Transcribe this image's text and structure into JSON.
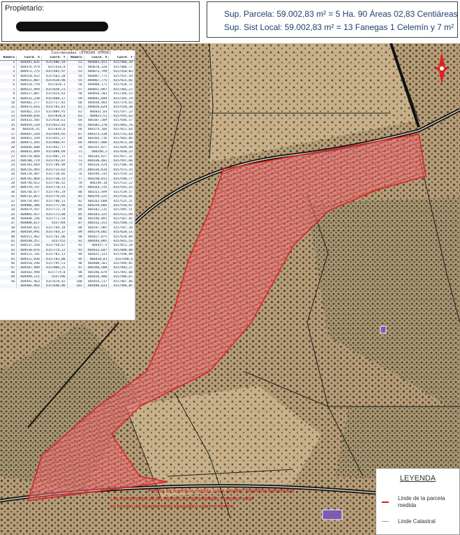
{
  "header": {
    "owner_label": "Propietario:",
    "surface_parcel": "Sup. Parcela: 59.002,83 m² = 5 Ha.  90 Áreas 02,83 Centiáreas",
    "surface_local": "Sup. Sist Local: 59.002,83 m² = 13 Fanegas 1 Celemín y 7 m²"
  },
  "coords": {
    "title": "Coordenadas (ETRS89 UTM30)",
    "headers": [
      "Número",
      "Coord. X",
      "Coord. Y",
      "Número",
      "Coord. X",
      "Coord. Y"
    ],
    "rows": [
      [
        "1",
        "404491,835",
        "4157406,59",
        "51",
        "404883,453",
        "4157406,39"
      ],
      [
        "2",
        "404476,979",
        "4157418,8",
        "52",
        "404878,226",
        "4157406,77"
      ],
      [
        "3",
        "404471,775",
        "4157485,97",
        "53",
        "404871,799",
        "4157410,03"
      ],
      [
        "4",
        "404510,932",
        "4157563,28",
        "54",
        "404867,773",
        "4157415,59"
      ],
      [
        "5",
        "404511,007",
        "4157618,88",
        "55",
        "404867,775",
        "4157421,82"
      ],
      [
        "6",
        "404510,759",
        "4157618,1",
        "56",
        "404860,171",
        "4157428,71"
      ],
      [
        "7",
        "404521,994",
        "4157658,21",
        "57",
        "404851,097",
        "4157381,17"
      ],
      [
        "8",
        "404527,007",
        "4157624,63",
        "58",
        "404856,203",
        "4157346,53"
      ],
      [
        "9",
        "404531,238",
        "4157668,17",
        "59",
        "404841,499",
        "4157345,79"
      ],
      [
        "10",
        "404482,277",
        "4157727,83",
        "60",
        "404838,403",
        "4157378,63"
      ],
      [
        "11",
        "404473,616",
        "4157781,61",
        "61",
        "404826,629",
        "4157510,38"
      ],
      [
        "12",
        "404462,153",
        "4157809,91",
        "62",
        "404832,03",
        "4157547,23"
      ],
      [
        "13",
        "404448,836",
        "4157818,8",
        "63",
        "404823,51",
        "4157591,62"
      ],
      [
        "14",
        "404433,505",
        "4157818,61",
        "64",
        "404387,509",
        "4157646,57"
      ],
      [
        "15",
        "404419,128",
        "4157823,83",
        "65",
        "404381,278",
        "4157681,76"
      ],
      [
        "16",
        "404434,41",
        "4157834,6",
        "66",
        "404374,186",
        "4157812,64"
      ],
      [
        "17",
        "404447,328",
        "4157844,92",
        "67",
        "404373,138",
        "4157752,64"
      ],
      [
        "18",
        "404851,549",
        "4157855,27",
        "68",
        "404364,716",
        "4157683,86"
      ],
      [
        "19",
        "404871,392",
        "4157860,97",
        "69",
        "404357,406",
        "4157672,38"
      ],
      [
        "20",
        "404846,600",
        "4157842,77",
        "70",
        "404355,077",
        "4157649,98"
      ],
      [
        "21",
        "404831,049",
        "4157808,69",
        "71",
        "404350,2",
        "4157658,23"
      ],
      [
        "22",
        "404718,860",
        "4157807,15",
        "72",
        "404344,827",
        "4157617,32"
      ],
      [
        "23",
        "404708,774",
        "4157793,87",
        "73",
        "404336,401",
        "4157597,66"
      ],
      [
        "24",
        "404703,669",
        "4157789,89",
        "74",
        "404326,424",
        "4157586,38"
      ],
      [
        "25",
        "404716,492",
        "4157713,62",
        "75",
        "404316,614",
        "4157573,15"
      ],
      [
        "26",
        "404728,407",
        "4157710,05",
        "76",
        "404294,235",
        "4157559,33"
      ],
      [
        "27",
        "404742,064",
        "4157730,15",
        "77",
        "404250,011",
        "4157548,77"
      ],
      [
        "28",
        "404748,652",
        "4157746,42",
        "78",
        "404249,18",
        "4157532,22"
      ],
      [
        "29",
        "404759,747",
        "4157778,11",
        "79",
        "404263,735",
        "4157541,32"
      ],
      [
        "30",
        "404740,077",
        "4157795,19",
        "80",
        "404253,499",
        "4157539,57"
      ],
      [
        "31",
        "404732,827",
        "4157776,65",
        "81",
        "404259,225",
        "4157516,81"
      ],
      [
        "32",
        "404718,097",
        "4157780,31",
        "82",
        "404263,608",
        "4157525,21"
      ],
      [
        "33",
        "404806,306",
        "4157777,66",
        "83",
        "404259,605",
        "4157510,87"
      ],
      [
        "34",
        "404879,597",
        "4157773,74",
        "84",
        "404182,135",
        "4157495,51"
      ],
      [
        "35",
        "404881,927",
        "4157773,68",
        "85",
        "404183,225",
        "4157511,99"
      ],
      [
        "36",
        "404848,146",
        "4157772,54",
        "86",
        "404196,095",
        "4157507,85"
      ],
      [
        "37",
        "404808,617",
        "4157784",
        "87",
        "404312,151",
        "4157568,72"
      ],
      [
        "38",
        "404584,021",
        "4157769,28",
        "88",
        "404347,985",
        "4157587,36"
      ],
      [
        "39",
        "404569,991",
        "4157764,37",
        "89",
        "404379,602",
        "4157628,11"
      ],
      [
        "40",
        "404551,962",
        "4157761,06",
        "90",
        "404427,075",
        "4157634,09"
      ],
      [
        "41",
        "404540,257",
        "4157752",
        "91",
        "404444,095",
        "4157641,53"
      ],
      [
        "42",
        "404537,358",
        "4157758,67",
        "92",
        "404457,5",
        "4157651,28"
      ],
      [
        "43",
        "404530,076",
        "4157774,12",
        "93",
        "404432,647",
        "4157608,88"
      ],
      [
        "44",
        "404521,781",
        "4157783,13",
        "94",
        "404425,313",
        "4157590,89"
      ],
      [
        "45",
        "404512,936",
        "4157783,08",
        "95",
        "404410,81",
        "4157590,4"
      ],
      [
        "46",
        "404510,298",
        "4157795,51",
        "96",
        "404408,281",
        "4157499,85"
      ],
      [
        "47",
        "404507,989",
        "4157804,25",
        "97",
        "404396,508",
        "4157493,27"
      ],
      [
        "48",
        "404503,998",
        "4157774,8",
        "98",
        "404396,879",
        "4157491,08"
      ],
      [
        "49",
        "404499,115",
        "4157706",
        "99",
        "404426,406",
        "4157448,67"
      ],
      [
        "50",
        "404492,463",
        "4157678,42",
        "100",
        "404454,217",
        "4157407,86"
      ],
      [
        "",
        "404466,964",
        "4157640,06",
        "101",
        "404480,833",
        "4157448,85"
      ]
    ]
  },
  "legend": {
    "title": "LEYENDA",
    "items": [
      {
        "label": "Linde de la parcela medida",
        "color": "#d9231f"
      },
      {
        "label": "Linde Catastral",
        "color": "#999999"
      }
    ]
  },
  "map_warnings": [
    "Parcela de superficie medida sobre ortofoto. Superficie aproximada",
    "Las coordenadas de los vértices son aproximadas y pueden variar",
    "en función del levantamiento topográfico sobre el terreno."
  ],
  "north_arrow_icon": "compass-rose-icon",
  "colors": {
    "parcel_fill": "#e7747d",
    "parcel_border": "#d9231f",
    "ground": "#b49a78",
    "road": "#1a1a1a"
  }
}
